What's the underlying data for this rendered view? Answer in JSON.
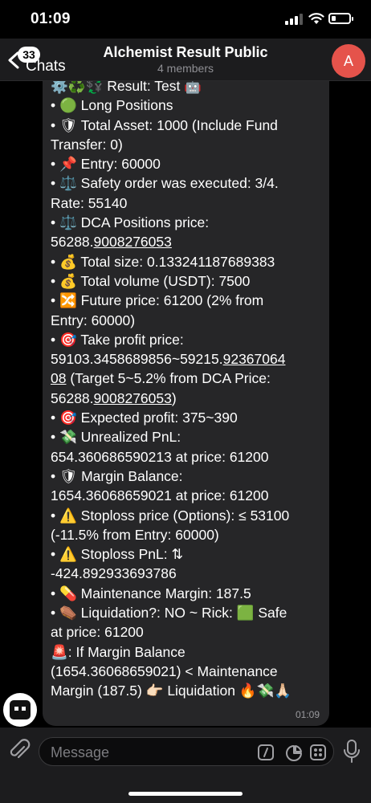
{
  "status_bar": {
    "time": "01:09",
    "battery_level": 0.25
  },
  "header": {
    "back_badge": "33",
    "back_label": "Chats",
    "title": "Alchemist Result Public",
    "subtitle": "4 members",
    "avatar_letter": "A"
  },
  "message": {
    "time": "01:09",
    "lines": [
      {
        "emoji": "⚙️♻️💱",
        "text": " Result: Test 🤖"
      },
      {
        "text": "• 🟢 Long Positions"
      },
      {
        "text": "• 🛡 Total Asset: 1000 (Include Fund"
      },
      {
        "text": "Transfer: 0)"
      },
      {
        "text": "• 📌 Entry: 60000"
      },
      {
        "text": "• ⚖️ Safety order was executed: 3/4."
      },
      {
        "text": "Rate: 55140"
      },
      {
        "text": "• ⚖️ DCA Positions price:"
      },
      {
        "text": "56288.",
        "u": "9008276053"
      },
      {
        "text": "• 💰 Total size: 0.133241187689383"
      },
      {
        "text": "• 💰 Total volume (USDT): 7500"
      },
      {
        "text": "• 🔀 Future price: 61200 (2% from"
      },
      {
        "text": "Entry: 60000)"
      },
      {
        "text": "• 🎯 Take profit price:"
      },
      {
        "text": "59103.3458689856~59215.",
        "u": "92367064"
      },
      {
        "u": "08",
        "text_after": " (Target 5~5.2% from DCA Price:"
      },
      {
        "text": "56288.",
        "u": "9008276053",
        "text_after": ")"
      },
      {
        "text": "• 🎯 Expected profit: 375~390"
      },
      {
        "text": "• 💸 Unrealized PnL:"
      },
      {
        "text": "654.360686590213 at price: 61200"
      },
      {
        "text": "• 🛡 Margin Balance:"
      },
      {
        "text": "1654.36068659021 at price: 61200"
      },
      {
        "text": "• ⚠️ Stoploss price (Options): ≤ 53100"
      },
      {
        "text": "(-11.5% from Entry: 60000)"
      },
      {
        "text": "• ⚠️ Stoploss PnL: ⇅"
      },
      {
        "text": "-424.892933693786"
      },
      {
        "text": "• 💊 Maintenance Margin: 187.5"
      },
      {
        "text": "• ⚰️ Liquidation?: NO ~ Rick: 🟩 Safe"
      },
      {
        "text": "at price: 61200"
      },
      {
        "text": "🚨: If Margin Balance"
      },
      {
        "text": "(1654.36068659021) < Maintenance"
      },
      {
        "text": "Margin (187.5) 👉🏻 Liquidation 🔥💸🙏🏻"
      }
    ]
  },
  "composer": {
    "placeholder": "Message"
  },
  "icons": {
    "back": "chevron-left-icon",
    "attach": "paperclip-icon",
    "command": "slash-command-icon",
    "sticker": "sticker-icon",
    "apps": "apps-grid-icon",
    "mic": "microphone-icon"
  },
  "colors": {
    "avatar": "#e5534b",
    "bubble": "#262628",
    "header": "#1c1c1e"
  }
}
